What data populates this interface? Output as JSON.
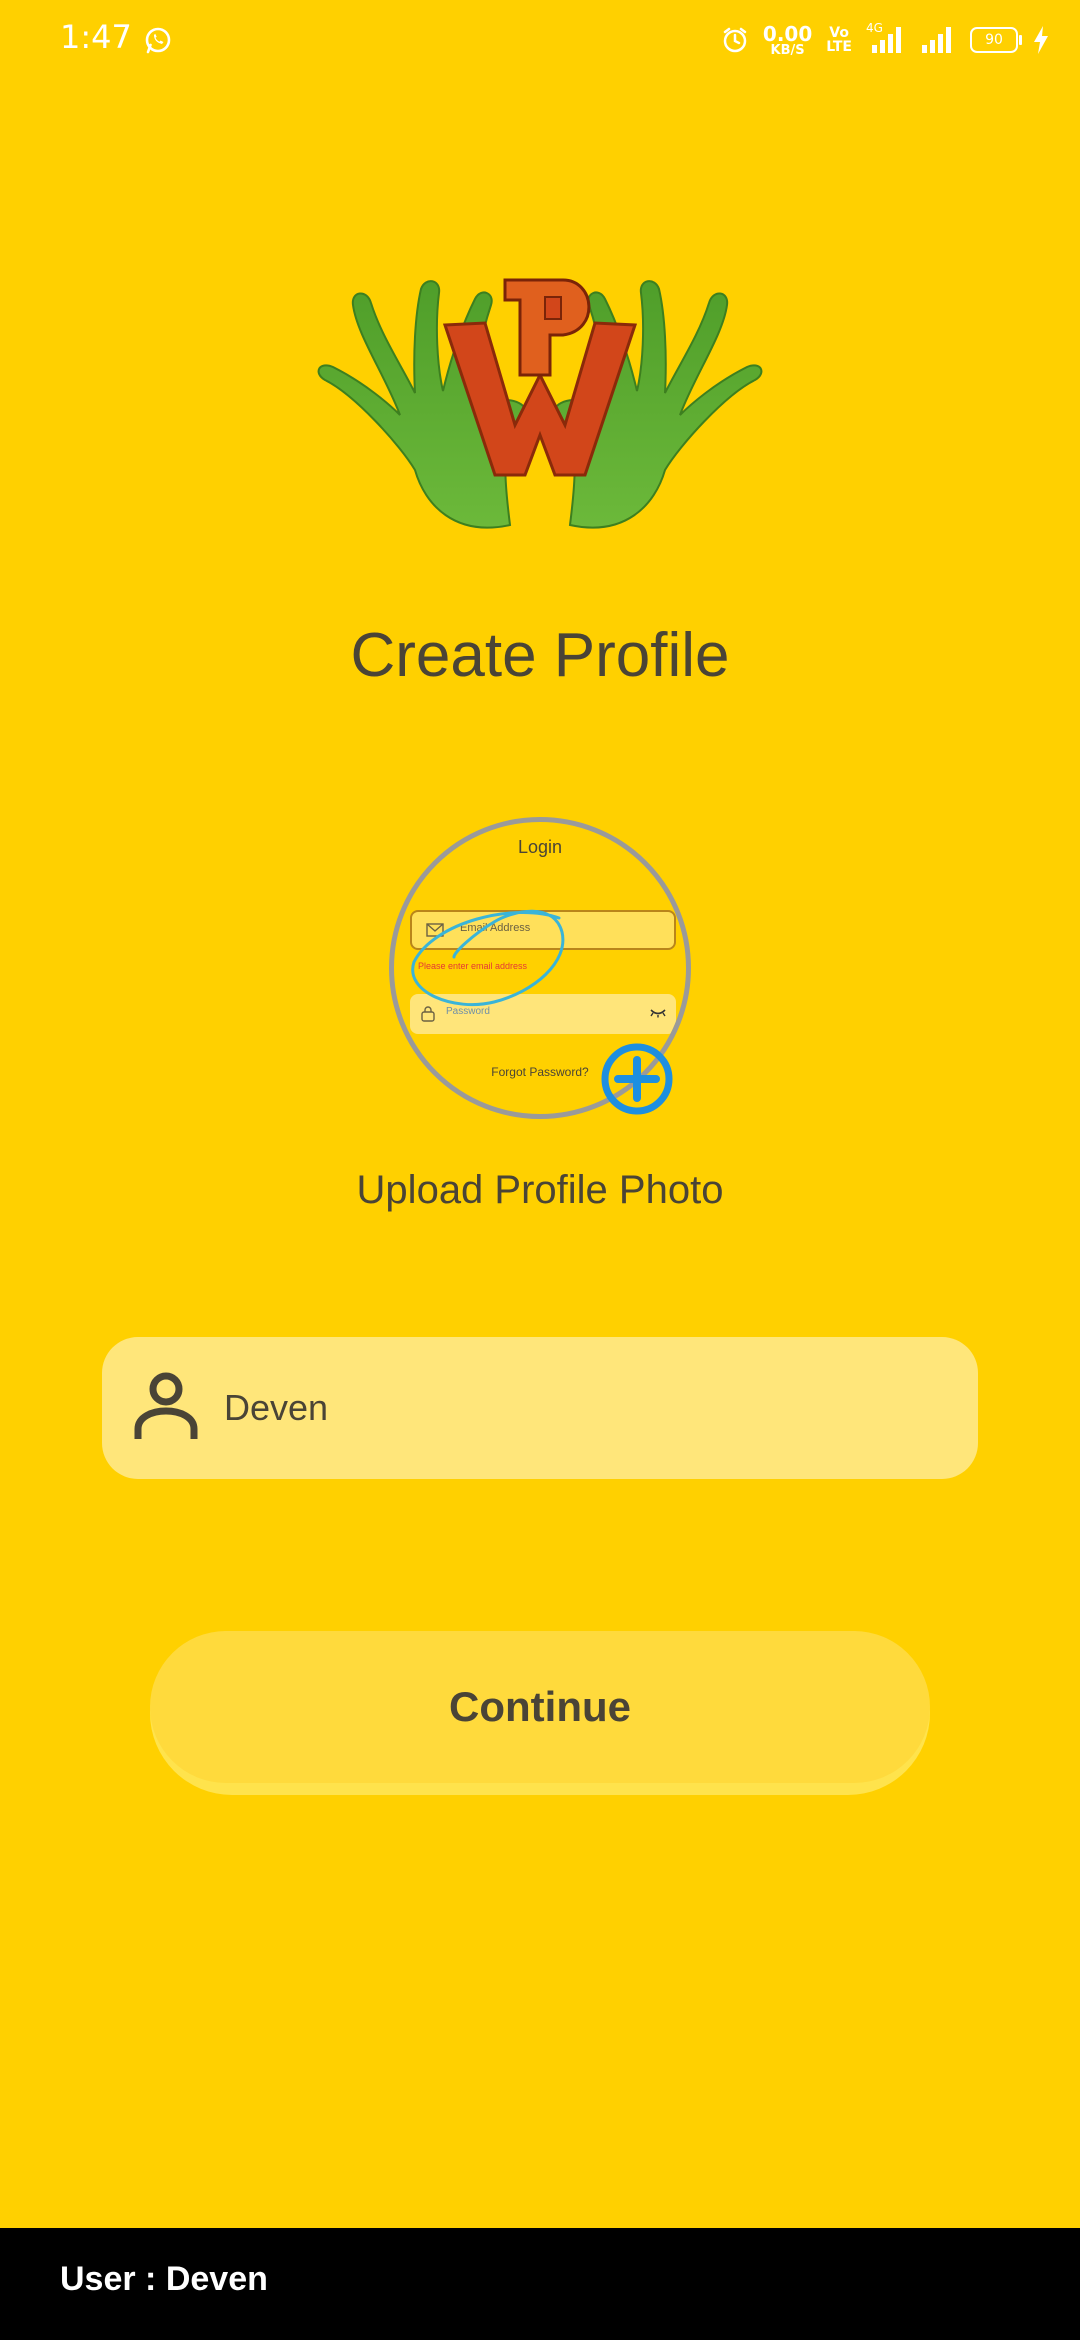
{
  "status_bar": {
    "time": "1:47",
    "net_speed_value": "0.00",
    "net_speed_unit": "KB/S",
    "volte_top": "Vo",
    "volte_bottom": "LTE",
    "network_type": "4G",
    "battery_level": "90"
  },
  "page": {
    "title": "Create Profile",
    "upload_label": "Upload Profile Photo"
  },
  "profile_photo_preview": {
    "login_title": "Login",
    "email_placeholder": "Email Address",
    "email_error": "Please enter email address",
    "password_placeholder": "Password",
    "forgot_password": "Forgot Password?"
  },
  "name_field": {
    "value": "Deven"
  },
  "continue_button": {
    "label": "Continue"
  },
  "bottom_bar": {
    "user_text": "User : Deven"
  },
  "colors": {
    "background": "#FFD000",
    "field_background": "#FFE67A",
    "button_background": "#FFDA3C",
    "text": "#4a4436",
    "add_icon": "#1E8FE0",
    "bottom_bar": "#000000"
  },
  "icons": {
    "whatsapp": "whatsapp-icon",
    "alarm": "alarm-icon",
    "signal": "signal-icon",
    "battery": "battery-icon",
    "charging": "charging-icon",
    "person": "person-icon",
    "add": "add-photo-icon"
  }
}
